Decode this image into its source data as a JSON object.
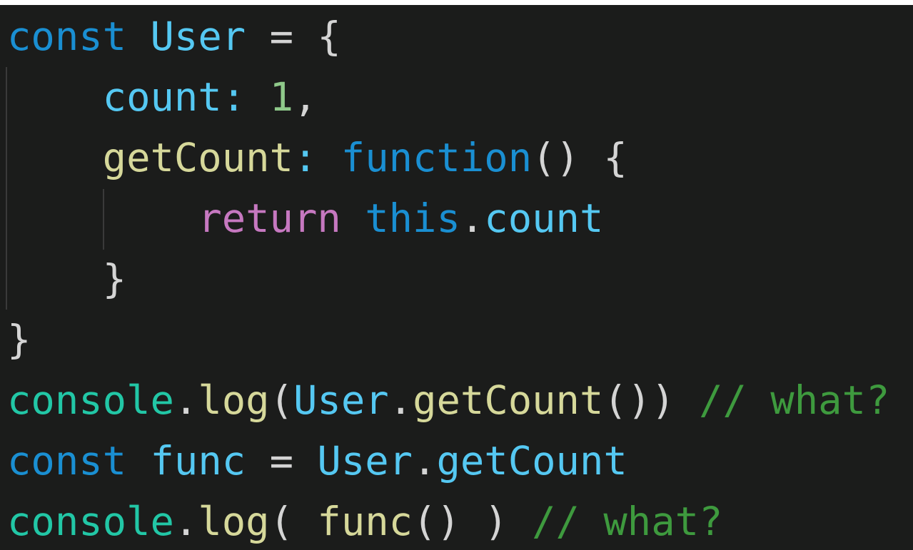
{
  "theme": {
    "background": "#1b1c1b",
    "keyword": "#1a8fd2",
    "variable": "#55c8f2",
    "property": "#55c8f2",
    "function": "#d6d89a",
    "number": "#8fc98a",
    "punctuation": "#d4d4d4",
    "control": "#c678c0",
    "object": "#22c7a6",
    "comment": "#3e9a3e"
  },
  "code": {
    "lines": [
      [
        {
          "t": "const",
          "c": "keyword"
        },
        {
          "t": " "
        },
        {
          "t": "User",
          "c": "variable"
        },
        {
          "t": " = { ",
          "c": "punctuation"
        }
      ],
      [
        {
          "t": "    "
        },
        {
          "t": "count",
          "c": "property"
        },
        {
          "t": ": ",
          "c": "property"
        },
        {
          "t": "1",
          "c": "number"
        },
        {
          "t": ",",
          "c": "punctuation"
        }
      ],
      [
        {
          "t": "    "
        },
        {
          "t": "getCount",
          "c": "function"
        },
        {
          "t": ": ",
          "c": "property"
        },
        {
          "t": "function",
          "c": "keyword"
        },
        {
          "t": "() {",
          "c": "punctuation"
        }
      ],
      [
        {
          "t": "        "
        },
        {
          "t": "return",
          "c": "control"
        },
        {
          "t": " "
        },
        {
          "t": "this",
          "c": "keyword"
        },
        {
          "t": ".",
          "c": "punctuation"
        },
        {
          "t": "count",
          "c": "property"
        }
      ],
      [
        {
          "t": "    "
        },
        {
          "t": "}",
          "c": "punctuation"
        }
      ],
      [
        {
          "t": "}",
          "c": "punctuation"
        }
      ],
      [
        {
          "t": "console",
          "c": "object"
        },
        {
          "t": ".",
          "c": "punctuation"
        },
        {
          "t": "log",
          "c": "function"
        },
        {
          "t": "(",
          "c": "punctuation"
        },
        {
          "t": "User",
          "c": "variable"
        },
        {
          "t": ".",
          "c": "punctuation"
        },
        {
          "t": "getCount",
          "c": "function"
        },
        {
          "t": "())",
          "c": "punctuation"
        },
        {
          "t": " "
        },
        {
          "t": "// what?",
          "c": "comment"
        }
      ],
      [
        {
          "t": "const",
          "c": "keyword"
        },
        {
          "t": " "
        },
        {
          "t": "func",
          "c": "variable"
        },
        {
          "t": " = ",
          "c": "punctuation"
        },
        {
          "t": "User",
          "c": "variable"
        },
        {
          "t": ".",
          "c": "punctuation"
        },
        {
          "t": "getCount",
          "c": "variable"
        }
      ],
      [
        {
          "t": "console",
          "c": "object"
        },
        {
          "t": ".",
          "c": "punctuation"
        },
        {
          "t": "log",
          "c": "function"
        },
        {
          "t": "( ",
          "c": "punctuation"
        },
        {
          "t": "func",
          "c": "function"
        },
        {
          "t": "() )",
          "c": "punctuation"
        },
        {
          "t": " "
        },
        {
          "t": "// what?",
          "c": "comment"
        }
      ]
    ]
  }
}
